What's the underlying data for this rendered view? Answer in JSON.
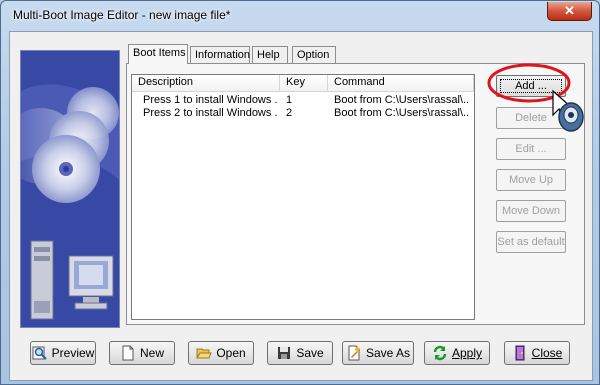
{
  "window": {
    "title": "Multi-Boot Image Editor - new image file*",
    "close_glyph": "✕"
  },
  "tabs": [
    {
      "label": "Boot Items",
      "active": true
    },
    {
      "label": "Information",
      "active": false
    },
    {
      "label": "Help",
      "active": false
    },
    {
      "label": "Option",
      "active": false
    }
  ],
  "list": {
    "columns": [
      "Description",
      "Key",
      "Command"
    ],
    "rows": [
      {
        "description": "Press 1 to install Windows ...",
        "key": "1",
        "command": "Boot from C:\\Users\\rassal\\..."
      },
      {
        "description": "Press 2 to install Windows ...",
        "key": "2",
        "command": "Boot from C:\\Users\\rassal\\..."
      }
    ]
  },
  "side_buttons": {
    "add": "Add ...",
    "delete": "Delete",
    "edit": "Edit ...",
    "move_up": "Move Up",
    "move_down": "Move Down",
    "set_default": "Set as default"
  },
  "bottom_buttons": {
    "preview": "Preview",
    "new": "New",
    "open": "Open",
    "save": "Save",
    "save_as": "Save As",
    "apply": "Apply",
    "close": "Close"
  },
  "colors": {
    "highlight_circle": "#e0141c",
    "banner_blue": "#3848a5",
    "close_red": "#c8402a"
  }
}
